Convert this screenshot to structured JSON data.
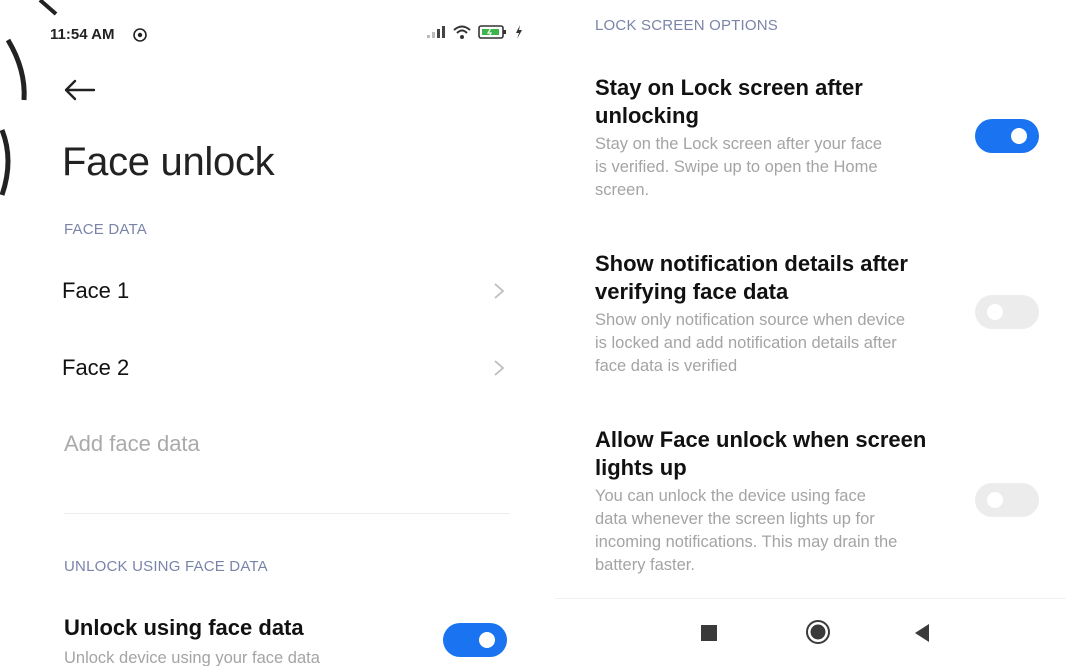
{
  "status_bar": {
    "time": "11:54 AM",
    "icons": [
      "settings-icon",
      "signal-icon",
      "wifi-icon",
      "battery-charging-icon",
      "charging-bolt-icon"
    ]
  },
  "left": {
    "back_icon": "arrow-left-icon",
    "title": "Face unlock",
    "face_data_section": "FACE DATA",
    "faces": [
      {
        "label": "Face 1"
      },
      {
        "label": "Face 2"
      }
    ],
    "add_face": "Add face data",
    "unlock_section": "UNLOCK USING FACE DATA",
    "unlock_option": {
      "title": "Unlock using face data",
      "description": "Unlock device using your face data",
      "enabled": true
    }
  },
  "right": {
    "section": "LOCK SCREEN OPTIONS",
    "options": [
      {
        "title_line1": "Stay on Lock screen after",
        "title_line2": "unlocking",
        "desc_line1": "Stay on the Lock screen after your face",
        "desc_line2": "is verified. Swipe up to open the Home",
        "desc_line3": "screen.",
        "enabled": true
      },
      {
        "title_line1": "Show notification details after",
        "title_line2": "verifying face data",
        "desc_line1": "Show only notification source when device",
        "desc_line2": "is locked and add notification details after",
        "desc_line3": "face data is verified",
        "enabled": false
      },
      {
        "title_line1": "Allow Face unlock when screen",
        "title_line2": "lights up",
        "desc_line1": "You can unlock the device using face",
        "desc_line2": "data whenever the screen lights up for",
        "desc_line3": "incoming notifications. This may drain the",
        "desc_line4": "battery faster.",
        "enabled": false
      }
    ],
    "nav": [
      "recents-square-icon",
      "home-circle-icon",
      "back-triangle-icon"
    ]
  },
  "colors": {
    "accent": "#1a73f0",
    "section_label": "#7a84a8",
    "secondary_text": "#a4a4a4",
    "toggle_off": "#ececec"
  }
}
